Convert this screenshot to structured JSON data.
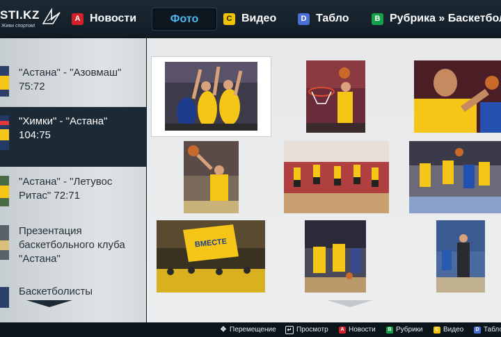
{
  "brand": {
    "name": "STI.KZ",
    "slogan": "Живи спортом!"
  },
  "nav": [
    {
      "key": "A",
      "label": "Новости"
    },
    {
      "key": "",
      "label": "Фото"
    },
    {
      "key": "C",
      "label": "Видео"
    },
    {
      "key": "D",
      "label": "Табло"
    },
    {
      "key": "B",
      "label": "Рубрика » Баскетбол"
    }
  ],
  "sidebar": {
    "items": [
      {
        "title": "\"Астана\" - \"Азовмаш\" 75:72"
      },
      {
        "title": "\"Химки\" - \"Астана\" 104:75"
      },
      {
        "title": "\"Астана\" - \"Летувос Ритас\" 72:71"
      },
      {
        "title": "Презентация баскетбольного клуба \"Астана\""
      },
      {
        "title": "Баскетболисты"
      }
    ]
  },
  "photos": {
    "banner_text": "ВМЕСТЕ"
  },
  "hints": [
    {
      "icon": "navigate-icon",
      "label": "Перемещение"
    },
    {
      "icon": "enter-icon",
      "label": "Просмотр"
    },
    {
      "key": "A",
      "label": "Новости"
    },
    {
      "key": "B",
      "label": "Рубрики"
    },
    {
      "key": "C",
      "label": "Видео"
    },
    {
      "key": "D",
      "label": "Табло"
    }
  ],
  "colors": {
    "accent": "#4fb8ec",
    "red": "#d51f2a",
    "yellow": "#f2c300",
    "blue": "#4a70d8",
    "green": "#15a24b",
    "team_yellow": "#f5c518"
  }
}
